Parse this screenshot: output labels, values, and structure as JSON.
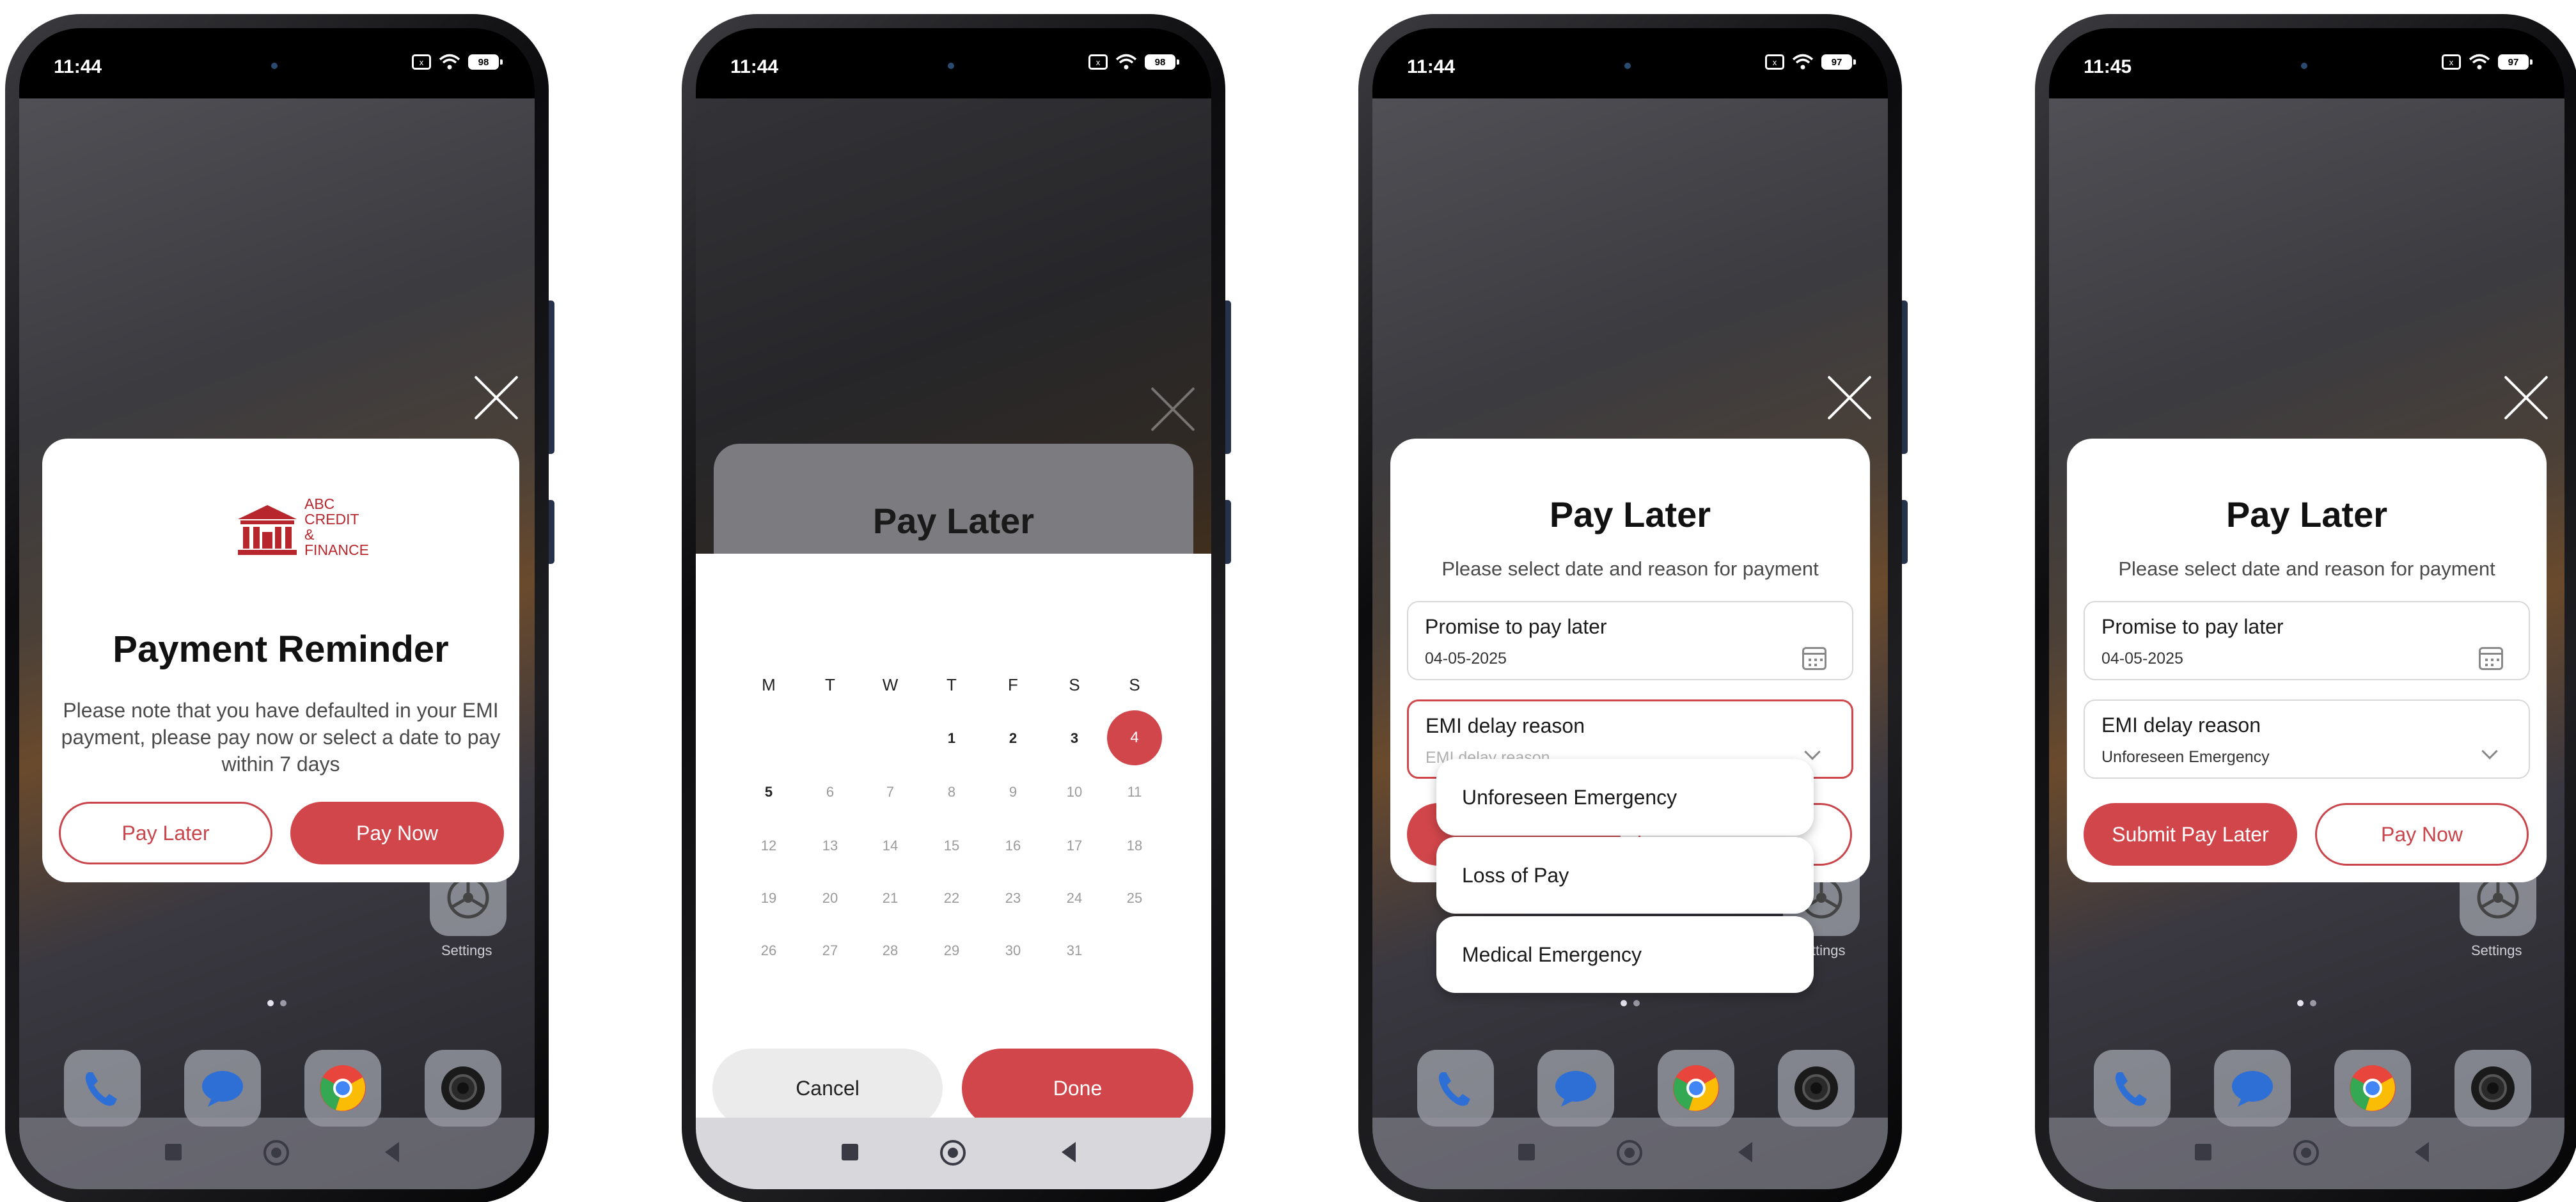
{
  "status": {
    "time": [
      "11:44",
      "11:44",
      "11:44",
      "11:45"
    ],
    "battery": [
      "98",
      "98",
      "97",
      "97"
    ],
    "sim_icon": "x"
  },
  "home": {
    "settings_label": "Settings"
  },
  "screen1": {
    "logo": {
      "line1": "ABC",
      "line2": "CREDIT",
      "line3": "&",
      "line4": "FINANCE"
    },
    "title": "Payment Reminder",
    "message": "Please note that you have defaulted in your EMI payment, please pay now or select a date to pay within 7 days",
    "pay_later_label": "Pay Later",
    "pay_now_label": "Pay Now"
  },
  "screen2": {
    "title": "Pay Later",
    "weekdays": [
      "M",
      "T",
      "W",
      "T",
      "F",
      "S",
      "S"
    ],
    "week1": [
      "1",
      "2",
      "3",
      "4"
    ],
    "week2": [
      "5",
      "6",
      "7",
      "8",
      "9",
      "10",
      "11"
    ],
    "week3": [
      "12",
      "13",
      "14",
      "15",
      "16",
      "17",
      "18"
    ],
    "week4": [
      "19",
      "20",
      "21",
      "22",
      "23",
      "24",
      "25"
    ],
    "week5": [
      "26",
      "27",
      "28",
      "29",
      "30",
      "31"
    ],
    "selected_day": "4",
    "cancel_label": "Cancel",
    "done_label": "Done"
  },
  "screen3": {
    "title": "Pay Later",
    "subtitle": "Please select date and reason for payment",
    "date_label": "Promise to pay later",
    "date_value": "04-05-2025",
    "reason_label": "EMI delay reason",
    "reason_placeholder": "EMI delay reason",
    "options": [
      "Unforeseen Emergency",
      "Loss of Pay",
      "Medical Emergency"
    ]
  },
  "screen4": {
    "title": "Pay Later",
    "subtitle": "Please select date and reason for payment",
    "date_label": "Promise to pay later",
    "date_value": "04-05-2025",
    "reason_label": "EMI delay reason",
    "reason_value": "Unforeseen Emergency",
    "submit_label": "Submit Pay Later",
    "pay_now_label": "Pay Now"
  },
  "colors": {
    "brand_red": "#d1464b",
    "logo_red": "#b8262d"
  }
}
